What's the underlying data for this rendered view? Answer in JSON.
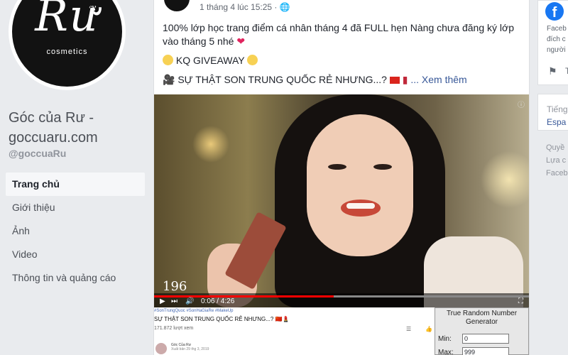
{
  "sidebar": {
    "page_name": "Góc của Rư - goccuaru.com",
    "handle": "@goccuaRu",
    "logo_text": "Rư",
    "logo_subtext": "cosmetics",
    "nav": [
      {
        "label": "Trang chủ",
        "active": true
      },
      {
        "label": "Giới thiệu",
        "active": false
      },
      {
        "label": "Ảnh",
        "active": false
      },
      {
        "label": "Video",
        "active": false
      },
      {
        "label": "Thông tin và quảng cáo",
        "active": false
      }
    ]
  },
  "post": {
    "timestamp": "1 tháng 4 lúc 15:25 ·",
    "privacy_icon": "globe-icon",
    "line1": "100% lớp học trang điểm cá nhân tháng 4 đã FULL hẹn Nàng chưa đăng ký lớp vào tháng 5 nhé",
    "line2": "KQ GIVEAWAY",
    "line3": "SỰ THẬT SON TRUNG QUỐC RẺ NHƯNG...?",
    "see_more": "... Xem thêm"
  },
  "video": {
    "overlay_number": "196",
    "time": "0:06 / 4:26",
    "progress": 0.48
  },
  "youtube_panel": {
    "tags": "#SonTrungQuoc #SonHaGiaRe #MakeUp",
    "title": "SỰ THẬT SON TRUNG QUỐC RẺ NHƯNG...?",
    "views": "171.872 lượt xem",
    "author": "Góc Của Rư",
    "date": "Xuất bản 29 thg 3, 2019"
  },
  "trng_widget": {
    "title": "True Random Number Generator",
    "min_label": "Min:",
    "min_value": "0",
    "max_label": "Max:",
    "max_value": "999"
  },
  "right_column": {
    "fb_text_1": "Faceb",
    "fb_text_2": "đích c",
    "fb_text_3": "người",
    "flag_label": "T",
    "lang_title": "Tiếng",
    "lang_link": "Espa",
    "footer_1": "Quyề",
    "footer_2": "Lựa c",
    "footer_3": "Faceb"
  },
  "colors": {
    "page_bg": "#e9ebee",
    "link": "#385898",
    "facebook_blue": "#1877f2",
    "progress_red": "#ff0000"
  }
}
